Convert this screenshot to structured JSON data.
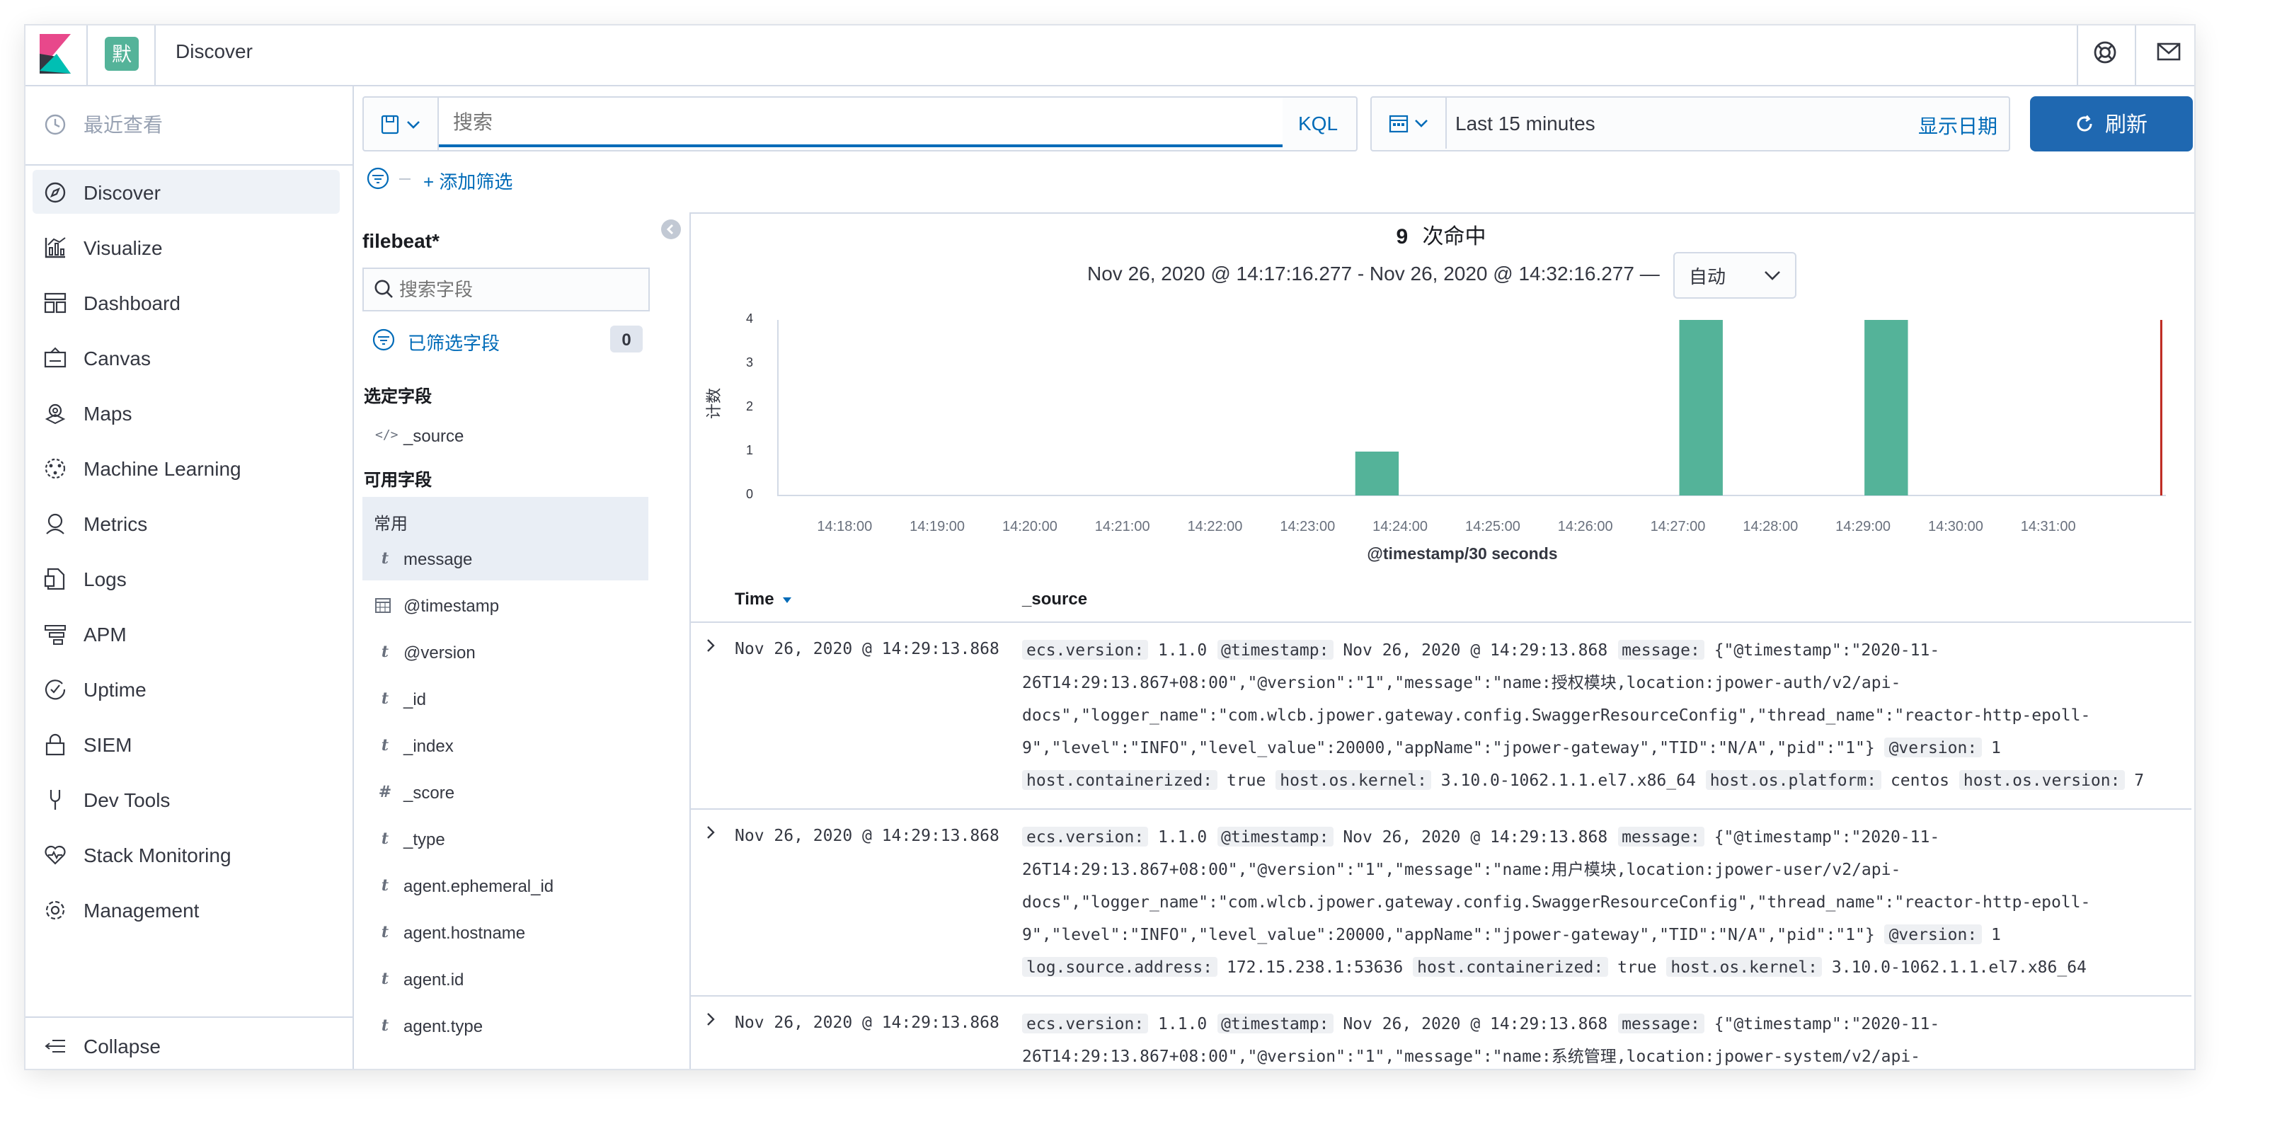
{
  "header": {
    "space_badge": "默",
    "app_title": "Discover"
  },
  "sidebar": {
    "recent_label": "最近查看",
    "items": [
      {
        "label": "Discover",
        "icon": "compass-icon"
      },
      {
        "label": "Visualize",
        "icon": "visualize-icon"
      },
      {
        "label": "Dashboard",
        "icon": "dashboard-icon"
      },
      {
        "label": "Canvas",
        "icon": "canvas-icon"
      },
      {
        "label": "Maps",
        "icon": "maps-icon"
      },
      {
        "label": "Machine Learning",
        "icon": "machine-learning-icon"
      },
      {
        "label": "Metrics",
        "icon": "metrics-icon"
      },
      {
        "label": "Logs",
        "icon": "logs-icon"
      },
      {
        "label": "APM",
        "icon": "apm-icon"
      },
      {
        "label": "Uptime",
        "icon": "uptime-icon"
      },
      {
        "label": "SIEM",
        "icon": "lock-icon"
      },
      {
        "label": "Dev Tools",
        "icon": "dev-tools-icon"
      },
      {
        "label": "Stack Monitoring",
        "icon": "heart-monitor-icon"
      },
      {
        "label": "Management",
        "icon": "gear-icon"
      }
    ],
    "collapse_label": "Collapse"
  },
  "query": {
    "search_placeholder": "搜索",
    "kql_label": "KQL",
    "time_range": "Last 15 minutes",
    "show_dates": "显示日期",
    "refresh_label": "刷新",
    "add_filter": "+ 添加筛选"
  },
  "fields": {
    "index_pattern": "filebeat*",
    "search_placeholder": "搜索字段",
    "filtered_label": "已筛选字段",
    "filtered_count": "0",
    "selected_heading": "选定字段",
    "selected": [
      {
        "type": "source",
        "name": "_source"
      }
    ],
    "available_heading": "可用字段",
    "popular_heading": "常用",
    "available": [
      {
        "type": "t",
        "name": "message"
      },
      {
        "type": "date",
        "name": "@timestamp"
      },
      {
        "type": "t",
        "name": "@version"
      },
      {
        "type": "t",
        "name": "_id"
      },
      {
        "type": "t",
        "name": "_index"
      },
      {
        "type": "#",
        "name": "_score"
      },
      {
        "type": "t",
        "name": "_type"
      },
      {
        "type": "t",
        "name": "agent.ephemeral_id"
      },
      {
        "type": "t",
        "name": "agent.hostname"
      },
      {
        "type": "t",
        "name": "agent.id"
      },
      {
        "type": "t",
        "name": "agent.type"
      }
    ]
  },
  "hits": {
    "count": "9",
    "label": "次命中",
    "range": "Nov 26, 2020 @ 14:17:16.277 - Nov 26, 2020 @ 14:32:16.277 —",
    "interval": "自动"
  },
  "chart_data": {
    "type": "bar",
    "xlabel": "@timestamp/30 seconds",
    "ylabel": "计数",
    "ylim": [
      0,
      4
    ],
    "yticks": [
      0,
      1,
      2,
      3,
      4
    ],
    "xticks": [
      "14:18:00",
      "14:19:00",
      "14:20:00",
      "14:21:00",
      "14:22:00",
      "14:23:00",
      "14:24:00",
      "14:25:00",
      "14:26:00",
      "14:27:00",
      "14:28:00",
      "14:29:00",
      "14:30:00",
      "14:31:00"
    ],
    "x": [
      "14:23:30",
      "14:27:00",
      "14:29:00"
    ],
    "values": [
      1,
      4,
      4
    ],
    "bar_color": "#54b399",
    "now_marker": "14:32:16",
    "now_marker_color": "#bd271e"
  },
  "table": {
    "col_time": "Time",
    "col_source": "_source",
    "rows": [
      {
        "time": "Nov 26, 2020 @ 14:29:13.868",
        "lines": [
          [
            [
              "ecs.version:",
              " 1.1.0 "
            ],
            [
              "@timestamp:",
              " Nov 26, 2020 @ 14:29:13.868 "
            ],
            [
              "message:",
              " {\"@timestamp\":\"2020-11-"
            ]
          ],
          [
            [
              "",
              "26T14:29:13.867+08:00\",\"@version\":\"1\",\"message\":\"name:授权模块,location:jpower-auth/v2/api-"
            ]
          ],
          [
            [
              "",
              "docs\",\"logger_name\":\"com.wlcb.jpower.gateway.config.SwaggerResourceConfig\",\"thread_name\":\"reactor-http-epoll-"
            ]
          ],
          [
            [
              "",
              "9\",\"level\":\"INFO\",\"level_value\":20000,\"appName\":\"jpower-gateway\",\"TID\":\"N/A\",\"pid\":\"1\"} "
            ],
            [
              "@version:",
              " 1"
            ]
          ],
          [
            [
              "host.containerized:",
              " true "
            ],
            [
              "host.os.kernel:",
              " 3.10.0-1062.1.1.el7.x86_64 "
            ],
            [
              "host.os.platform:",
              " centos "
            ],
            [
              "host.os.version:",
              " 7"
            ]
          ]
        ]
      },
      {
        "time": "Nov 26, 2020 @ 14:29:13.868",
        "lines": [
          [
            [
              "ecs.version:",
              " 1.1.0 "
            ],
            [
              "@timestamp:",
              " Nov 26, 2020 @ 14:29:13.868 "
            ],
            [
              "message:",
              " {\"@timestamp\":\"2020-11-"
            ]
          ],
          [
            [
              "",
              "26T14:29:13.867+08:00\",\"@version\":\"1\",\"message\":\"name:用户模块,location:jpower-user/v2/api-"
            ]
          ],
          [
            [
              "",
              "docs\",\"logger_name\":\"com.wlcb.jpower.gateway.config.SwaggerResourceConfig\",\"thread_name\":\"reactor-http-epoll-"
            ]
          ],
          [
            [
              "",
              "9\",\"level\":\"INFO\",\"level_value\":20000,\"appName\":\"jpower-gateway\",\"TID\":\"N/A\",\"pid\":\"1\"} "
            ],
            [
              "@version:",
              " 1"
            ]
          ],
          [
            [
              "log.source.address:",
              " 172.15.238.1:53636 "
            ],
            [
              "host.containerized:",
              " true "
            ],
            [
              "host.os.kernel:",
              " 3.10.0-1062.1.1.el7.x86_64"
            ]
          ]
        ]
      },
      {
        "time": "Nov 26, 2020 @ 14:29:13.868",
        "lines": [
          [
            [
              "ecs.version:",
              " 1.1.0 "
            ],
            [
              "@timestamp:",
              " Nov 26, 2020 @ 14:29:13.868 "
            ],
            [
              "message:",
              " {\"@timestamp\":\"2020-11-"
            ]
          ],
          [
            [
              "",
              "26T14:29:13.867+08:00\",\"@version\":\"1\",\"message\":\"name:系统管理,location:jpower-system/v2/api-"
            ]
          ]
        ]
      }
    ]
  },
  "colors": {
    "primary": "#1f68b1",
    "link": "#006bb8",
    "kibana_pink": "#e8488b",
    "kibana_teal": "#00bfb3",
    "space_badge": "#54b399"
  }
}
